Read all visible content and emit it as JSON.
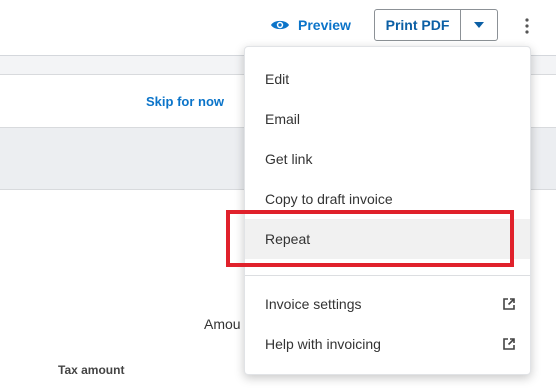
{
  "toolbar": {
    "preview_label": "Preview",
    "print_label": "Print PDF"
  },
  "banner": {
    "skip_label": "Skip for now"
  },
  "invoice": {
    "amount_label": "Amou",
    "tax_label": "Tax amount"
  },
  "menu": {
    "items": [
      {
        "label": "Edit"
      },
      {
        "label": "Email"
      },
      {
        "label": "Get link"
      },
      {
        "label": "Copy to draft invoice"
      },
      {
        "label": "Repeat"
      },
      {
        "label": "Invoice settings"
      },
      {
        "label": "Help with invoicing"
      }
    ]
  },
  "colors": {
    "accent": "#0b74c9",
    "highlight": "#e0212b",
    "menu_hover": "#f1f1f1"
  }
}
